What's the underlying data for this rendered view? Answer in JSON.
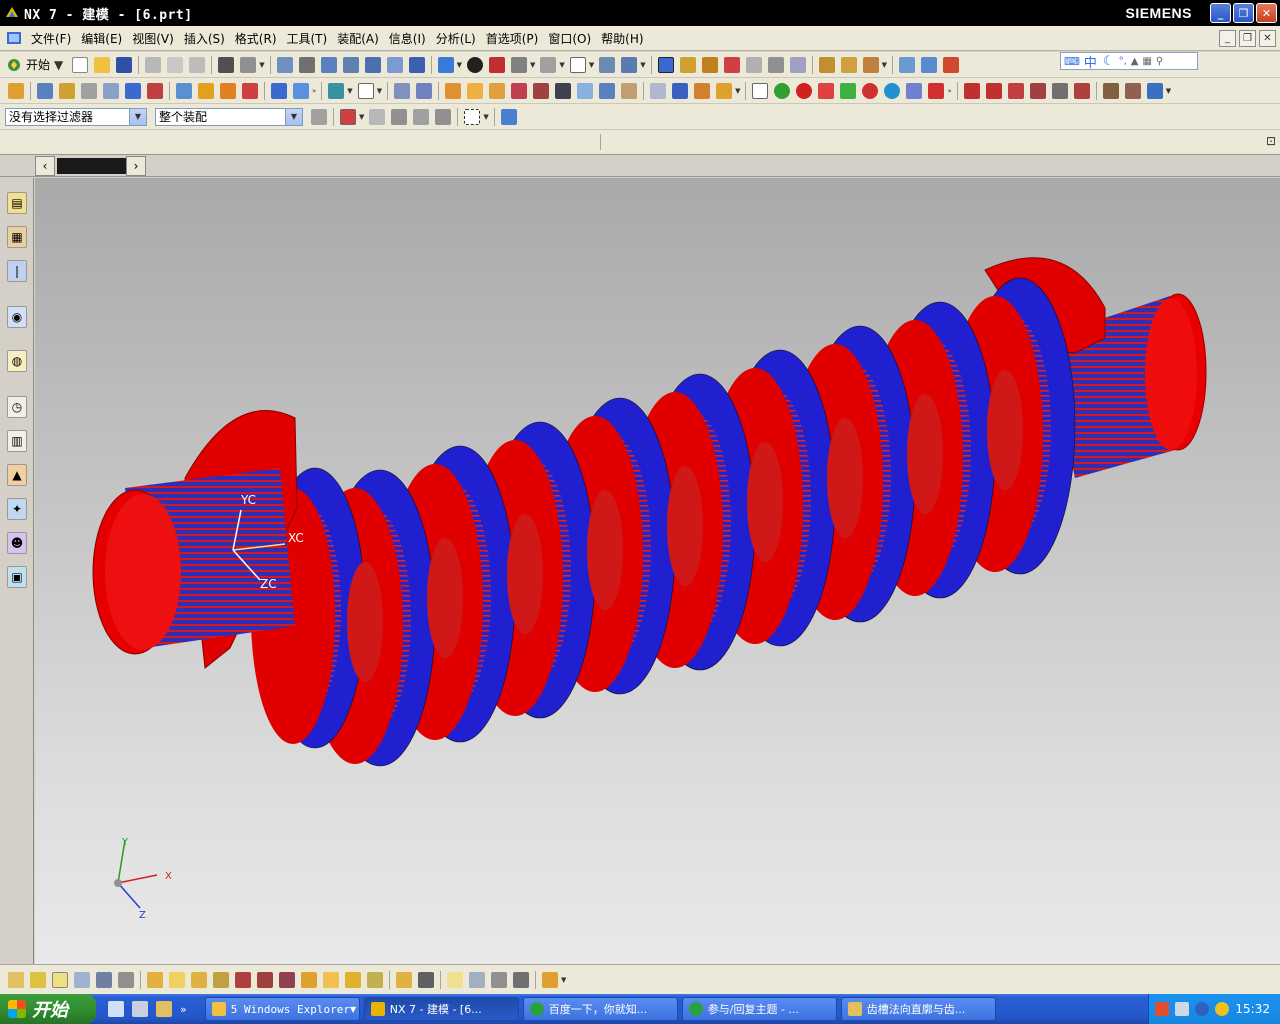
{
  "window": {
    "title": "NX 7 - 建模 - [6.prt]",
    "brand": "SIEMENS"
  },
  "menubar": {
    "items": [
      "文件(F)",
      "编辑(E)",
      "视图(V)",
      "插入(S)",
      "格式(R)",
      "工具(T)",
      "装配(A)",
      "信息(I)",
      "分析(L)",
      "首选项(P)",
      "窗口(O)",
      "帮助(H)"
    ]
  },
  "toolbar1": {
    "start_label": "开始"
  },
  "ime": {
    "mode": "中"
  },
  "selection": {
    "filter_value": "没有选择过滤器",
    "scope_value": "整个装配"
  },
  "viewport": {
    "wcs_labels": [
      "YC",
      "XC",
      "ZC"
    ],
    "triad_labels": [
      "Y",
      "X",
      "Z"
    ]
  },
  "taskbar": {
    "start_label": "开始",
    "tasks": [
      "5 Windows Explorer",
      "NX 7 - 建模 - [6...",
      "百度一下，你就知...",
      "参与/回复主题 - ...",
      "齿槽法向直廓与齿..."
    ],
    "clock": "15:32"
  },
  "colors": {
    "model_red": "#e00000",
    "model_blue": "#1a20d8",
    "taskbar_blue": "#2456c8",
    "start_green": "#2e8a2e"
  }
}
